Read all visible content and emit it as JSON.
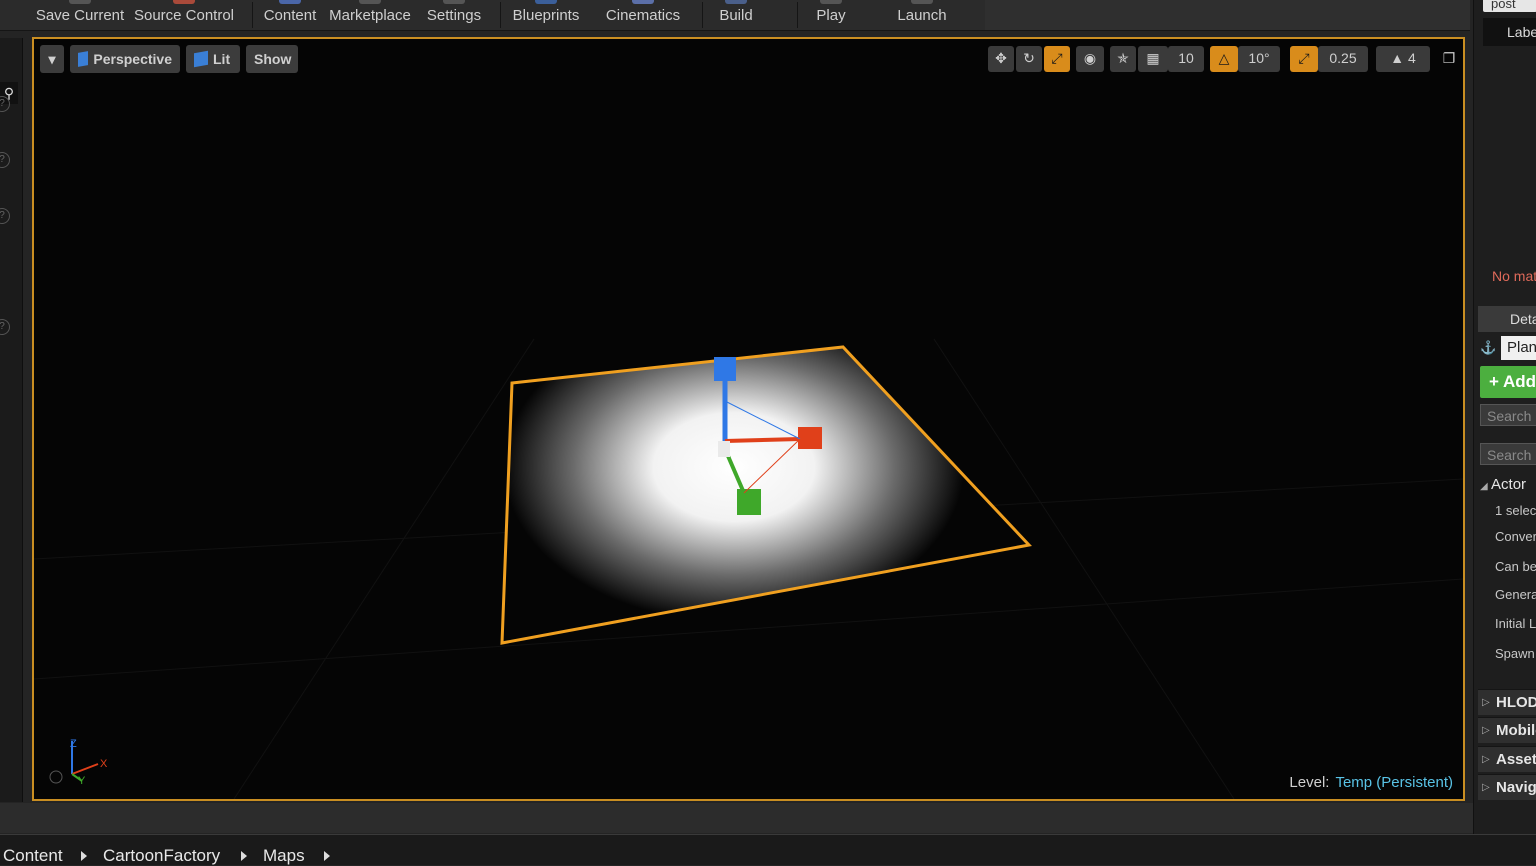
{
  "toolbar": {
    "buttons": [
      "Save Current",
      "Source Control",
      "Content",
      "Marketplace",
      "Settings",
      "Blueprints",
      "Cinematics",
      "Build",
      "Play",
      "Launch"
    ]
  },
  "viewport": {
    "view_mode": "Perspective",
    "lighting": "Lit",
    "show": "Show",
    "grid_snap_value": "10",
    "rotation_snap_value": "10°",
    "scale_snap_value": "0.25",
    "camera_speed": "4",
    "level_label": "Level:",
    "level_value": "Temp (Persistent)",
    "axis_x": "X",
    "axis_y": "Y",
    "axis_z": "Z",
    "colors": {
      "selection": "#f0a020",
      "x_axis": "#e0401a",
      "y_axis": "#3fa82a",
      "z_axis": "#2f78e6"
    }
  },
  "right_panel": {
    "search_tab": "post",
    "label_header": "Labe",
    "no_match": "No mat",
    "details_tab": "Deta",
    "actor_name": "Plan",
    "add_button": "+ Add",
    "search_1": "Search",
    "search_2": "Search",
    "actor_category": "Actor",
    "actor_props": [
      "1 selec",
      "Conver",
      "Can be",
      "Genera",
      "Initial L",
      "Spawn"
    ],
    "categories": [
      "HLOD",
      "Mobile",
      "Asset",
      "Naviga"
    ]
  },
  "breadcrumb": [
    "Content",
    "CartoonFactory",
    "Maps"
  ]
}
